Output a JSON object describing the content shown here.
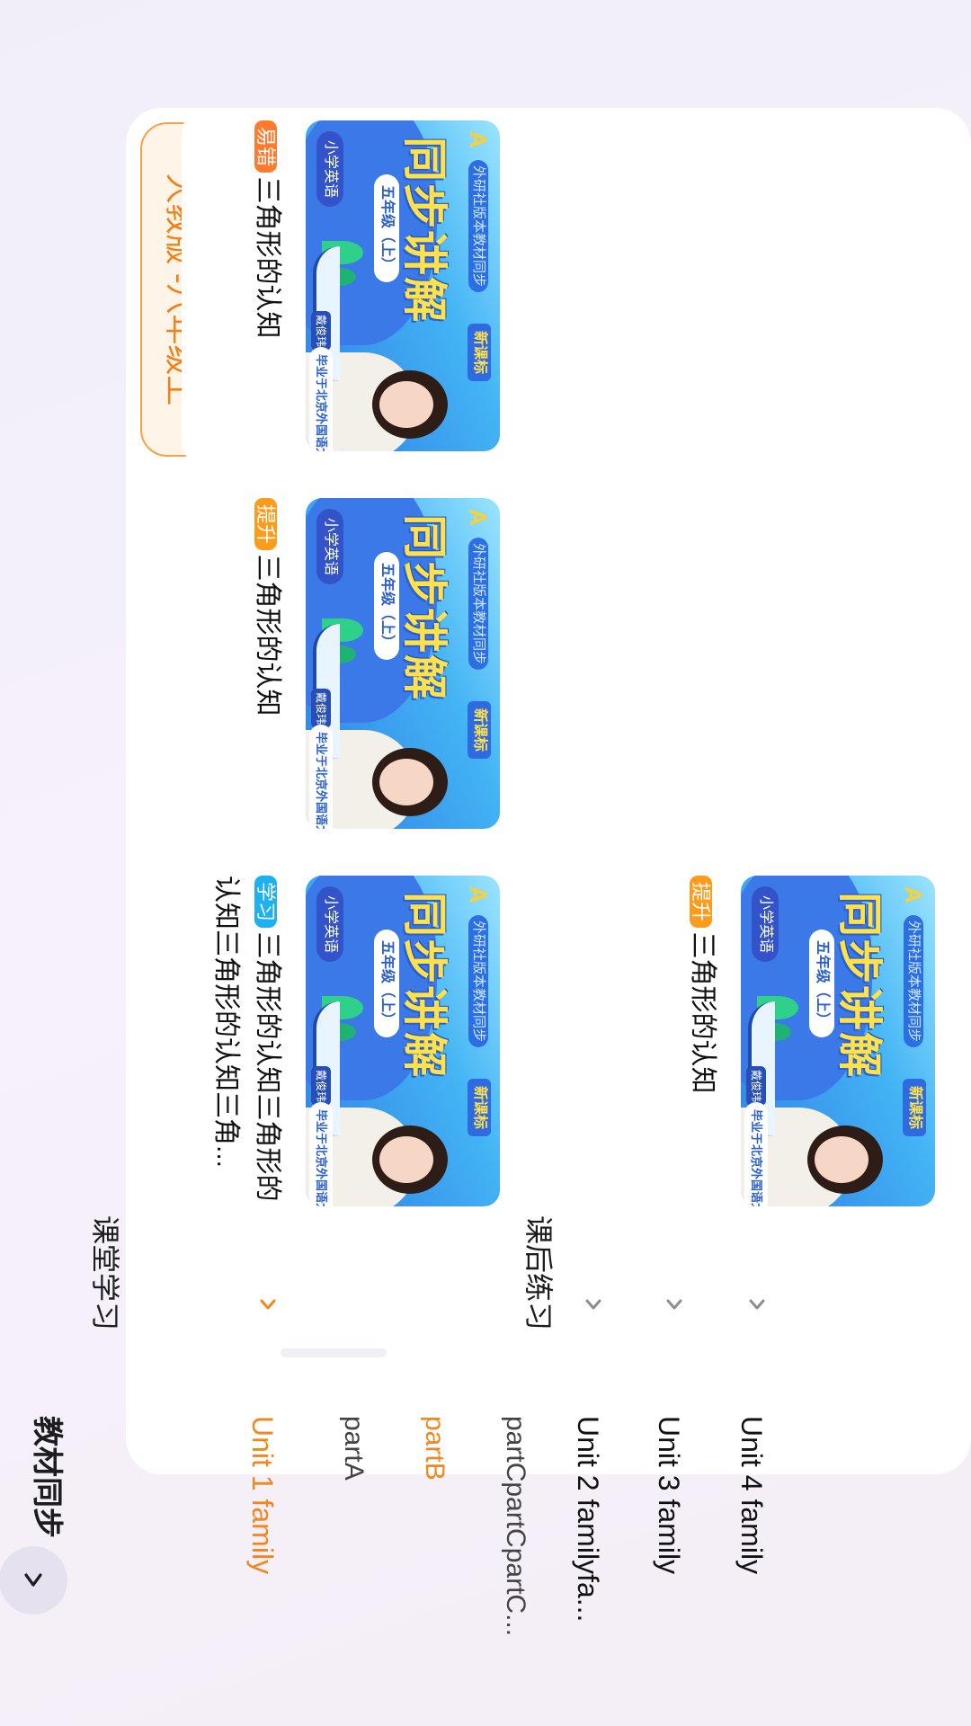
{
  "header": {
    "title": "教材同步"
  },
  "sidebar": {
    "version": "人教版 -八年级上",
    "units": [
      {
        "label": "Unit 1 family",
        "parts": [
          "partA",
          "partB",
          "partCpartCpartC..."
        ]
      },
      {
        "label": "Unit 2 familyfa..."
      },
      {
        "label": "Unit 3 family"
      },
      {
        "label": "Unit 4 family"
      }
    ]
  },
  "sections": {
    "classroom": "课堂学习",
    "homework": "课后练习"
  },
  "thumbnail": {
    "tagline": "外研社版本教材同步",
    "new_badge": "新课标",
    "subject": "小学英语",
    "headline": "同步讲解",
    "grade": "五年级（上）",
    "teacher_name": "戴俊玮",
    "teacher_note": "毕业于北京外国语大学"
  },
  "cards": [
    {
      "badge": "学习",
      "title": "三角形的认知三角形的认知三角形的认知三角..."
    },
    {
      "badge": "提升",
      "title": "三角形的认知"
    },
    {
      "badge": "易错",
      "title": "三角形的认知"
    },
    {
      "badge": "提升",
      "title": "三角形的认知"
    }
  ],
  "colors": {
    "accent": "#f4861d",
    "badge_learn": "#1fb0f0",
    "badge_up": "#ff9b1a",
    "badge_err": "#ff7a2d"
  }
}
